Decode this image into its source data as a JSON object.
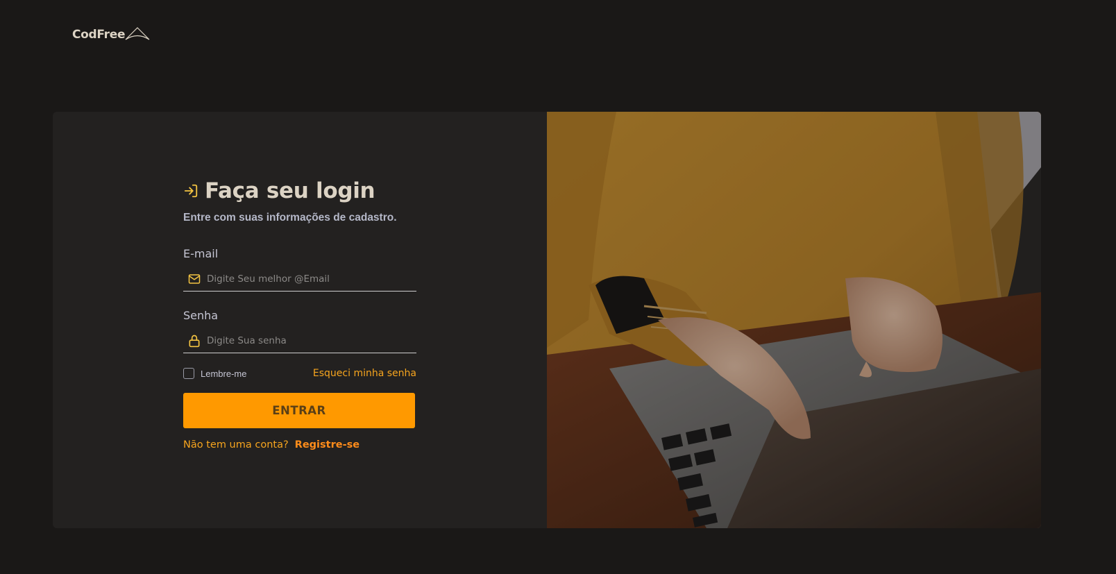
{
  "brand": {
    "name": "CodFree"
  },
  "login": {
    "title": "Faça seu login",
    "subtitle": "Entre com suas informações de cadastro.",
    "email": {
      "label": "E-mail",
      "placeholder": "Digite Seu melhor @Email",
      "value": ""
    },
    "password": {
      "label": "Senha",
      "placeholder": "Digite Sua senha",
      "value": ""
    },
    "remember_label": "Lembre-me",
    "forgot_label": "Esqueci minha senha",
    "submit_label": "ENTRAR",
    "register_question": "Não tem uma conta?",
    "register_link": "Registre-se"
  },
  "icons": {
    "title": "login-arrow-icon",
    "email": "mail-icon",
    "password": "lock-icon",
    "logo": "mountain-icon"
  },
  "colors": {
    "background": "#1a1817",
    "card": "#232120",
    "accent": "#ff9900",
    "link": "#f7a51e",
    "icon": "#f5c542"
  }
}
